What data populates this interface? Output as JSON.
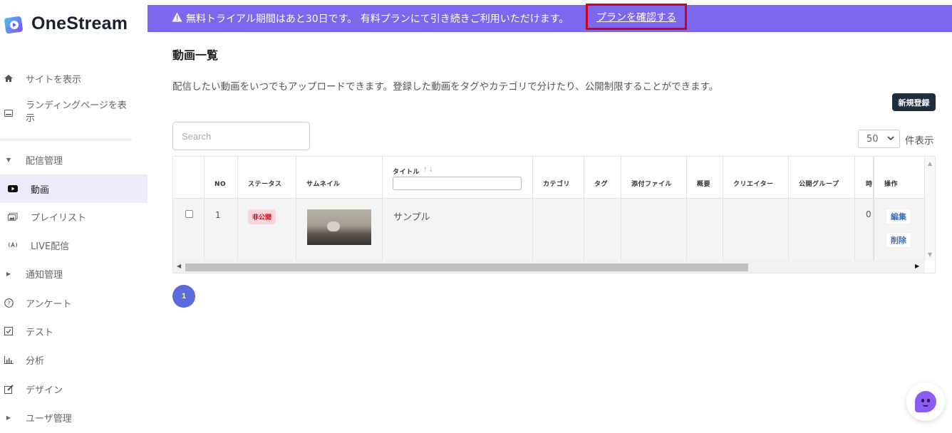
{
  "app": {
    "logo_text": "OneStream"
  },
  "banner": {
    "message": "無料トライアル期間はあと30日です。 有料プランにて引き続きご利用いただけます。",
    "link": "プランを確認する",
    "color": "#7b68ee",
    "highlight_color": "#d0021b"
  },
  "sidebar": {
    "items": [
      {
        "label": "サイトを表示",
        "icon": "home-icon"
      },
      {
        "label": "ランディングページを表示",
        "icon": "monitor-icon"
      },
      {
        "label": "配信管理",
        "icon": "caret-down-icon"
      },
      {
        "label": "動画",
        "icon": "youtube-icon",
        "active": true
      },
      {
        "label": "プレイリスト",
        "icon": "images-icon"
      },
      {
        "label": "LIVE配信",
        "icon": "broadcast-icon"
      },
      {
        "label": "通知管理",
        "icon": "caret-right-icon"
      },
      {
        "label": "アンケート",
        "icon": "question-circle-icon"
      },
      {
        "label": "テスト",
        "icon": "check-square-icon"
      },
      {
        "label": "分析",
        "icon": "bar-chart-icon"
      },
      {
        "label": "デザイン",
        "icon": "edit-icon"
      },
      {
        "label": "ユーザ管理",
        "icon": "caret-right-icon"
      }
    ]
  },
  "main": {
    "title": "動画一覧",
    "description": "配信したい動画をいつでもアップロードできます。登録した動画をタグやカテゴリで分けたり、公開制限することができます。",
    "new_button": "新規登録",
    "search_placeholder": "Search",
    "per_page_value": "50",
    "per_page_label": "件表示"
  },
  "table": {
    "columns": [
      "",
      "NO",
      "ステータス",
      "サムネイル",
      "タイトル",
      "カテゴリ",
      "タグ",
      "添付ファイル",
      "概要",
      "クリエイター",
      "公開グループ",
      "時",
      "操作"
    ],
    "sort_indicator": "↑↓",
    "rows": [
      {
        "no": "1",
        "status": "非公開",
        "title": "サンプル",
        "time_partial": "0",
        "edit": "編集",
        "delete": "削除"
      }
    ]
  },
  "pagination": {
    "current": "1"
  },
  "chat": {
    "icon": "chatbot-icon",
    "color": "#8b5cf6"
  }
}
